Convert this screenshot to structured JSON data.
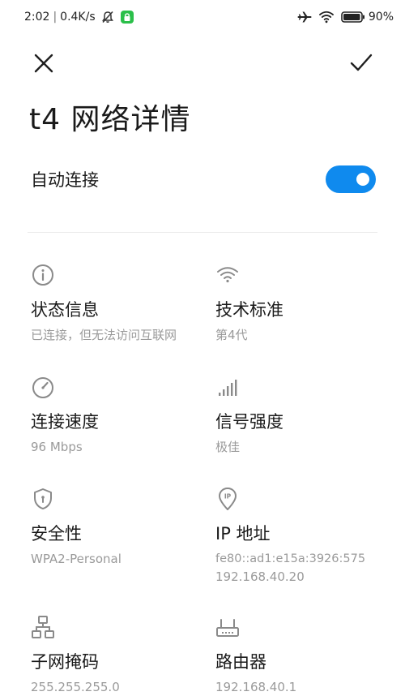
{
  "status_bar": {
    "time": "2:02",
    "network_speed": "0.4K/s",
    "battery": "90%"
  },
  "header": {
    "title": "t4 网络详情"
  },
  "auto_connect": {
    "label": "自动连接",
    "enabled": true,
    "accent_color": "#0f8aee"
  },
  "details": {
    "status": {
      "icon": "info-icon",
      "label": "状态信息",
      "value": "已连接，但无法访问互联网"
    },
    "tech_standard": {
      "icon": "wifi-icon",
      "label": "技术标准",
      "value": "第4代"
    },
    "link_speed": {
      "icon": "speedometer-icon",
      "label": "连接速度",
      "value": "96 Mbps"
    },
    "signal_strength": {
      "icon": "signal-bars-icon",
      "label": "信号强度",
      "value": "极佳"
    },
    "security": {
      "icon": "shield-icon",
      "label": "安全性",
      "value": "WPA2-Personal"
    },
    "ip_address": {
      "icon": "ip-location-icon",
      "label": "IP 地址",
      "value_ipv6": "fe80::ad1:e15a:3926:575",
      "value_ipv4": "192.168.40.20"
    },
    "subnet_mask": {
      "icon": "network-topology-icon",
      "label": "子网掩码",
      "value": "255.255.255.0"
    },
    "router": {
      "icon": "router-icon",
      "label": "路由器",
      "value": "192.168.40.1"
    }
  }
}
